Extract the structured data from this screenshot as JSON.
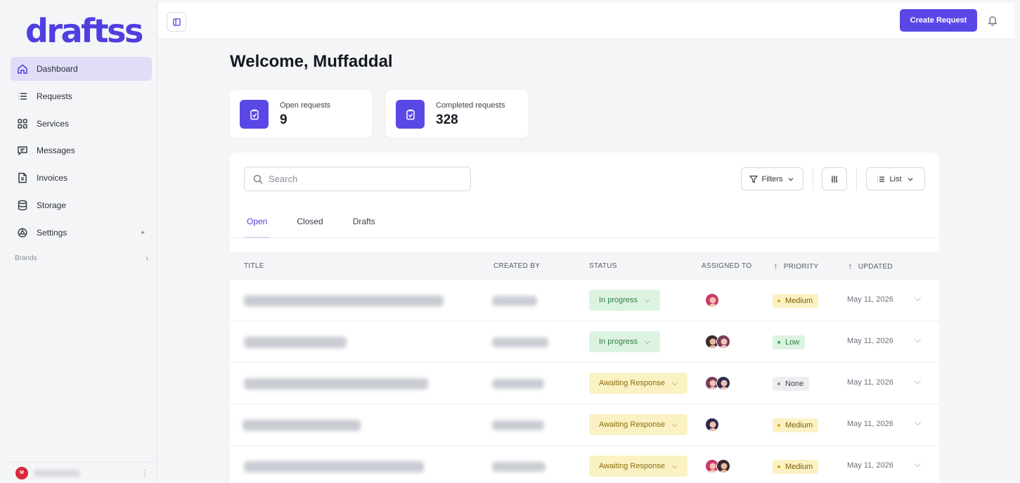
{
  "app": {
    "logo": "draftss"
  },
  "sidebar": {
    "items": [
      {
        "label": "Dashboard",
        "icon": "home-icon",
        "active": true
      },
      {
        "label": "Requests",
        "icon": "list-icon"
      },
      {
        "label": "Services",
        "icon": "grid-icon"
      },
      {
        "label": "Messages",
        "icon": "message-icon"
      },
      {
        "label": "Invoices",
        "icon": "invoice-icon"
      },
      {
        "label": "Storage",
        "icon": "database-icon"
      },
      {
        "label": "Settings",
        "icon": "gear-icon",
        "caret": "▸"
      }
    ],
    "brands_label": "Brands",
    "brands_chevron": "›",
    "user_initial": "M",
    "user_more": "⋮"
  },
  "topbar": {
    "create_label": "Create Request"
  },
  "main": {
    "welcome": "Welcome, Muffaddal",
    "stats": [
      {
        "label": "Open requests",
        "value": "9"
      },
      {
        "label": "Completed requests",
        "value": "328"
      }
    ],
    "search_placeholder": "Search",
    "filters_label": "Filters",
    "list_label": "List",
    "tabs": [
      {
        "label": "Open",
        "active": true
      },
      {
        "label": "Closed"
      },
      {
        "label": "Drafts"
      }
    ],
    "columns": {
      "title": "TITLE",
      "created_by": "CREATED BY",
      "status": "STATUS",
      "assigned_to": "ASSIGNED TO",
      "priority": "PRIORITY",
      "updated": "UPDATED",
      "sort_arrow": "↑"
    },
    "rows": [
      {
        "status": "In progress",
        "status_type": "progress",
        "priority": "Medium",
        "priority_type": "medium",
        "updated": "May 11, 2026",
        "avatars": 1
      },
      {
        "status": "In progress",
        "status_type": "progress",
        "priority": "Low",
        "priority_type": "low",
        "updated": "May 11, 2026",
        "avatars": 2
      },
      {
        "status": "Awaiting Response",
        "status_type": "awaiting",
        "priority": "None",
        "priority_type": "none",
        "updated": "May 11, 2026",
        "avatars": 2
      },
      {
        "status": "Awaiting Response",
        "status_type": "awaiting",
        "priority": "Medium",
        "priority_type": "medium",
        "updated": "May 11, 2026",
        "avatars": 1
      },
      {
        "status": "Awaiting Response",
        "status_type": "awaiting",
        "priority": "Medium",
        "priority_type": "medium",
        "updated": "May 11, 2026",
        "avatars": 2
      }
    ],
    "status_chevron": "⌵",
    "row_chevron": "⌵"
  },
  "colors": {
    "accent": "#5a48e6",
    "logo": "#4f3fe0"
  }
}
